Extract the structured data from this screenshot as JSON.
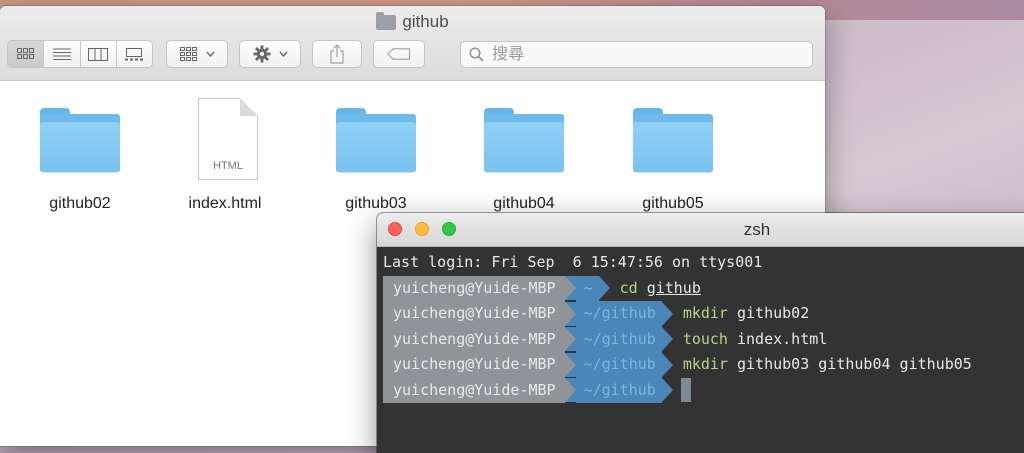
{
  "finder": {
    "title": "github",
    "search": {
      "placeholder": "搜尋"
    },
    "toolbar_icons": [
      "icon-view-grid",
      "list-view-icon",
      "column-view-icon",
      "gallery-view-icon",
      "arrange-icon",
      "gear-icon",
      "share-icon",
      "tag-icon"
    ],
    "files": [
      {
        "name": "github02",
        "kind": "folder"
      },
      {
        "name": "index.html",
        "kind": "document",
        "tag": "HTML"
      },
      {
        "name": "github03",
        "kind": "folder"
      },
      {
        "name": "github04",
        "kind": "folder"
      },
      {
        "name": "github05",
        "kind": "folder"
      }
    ]
  },
  "terminal": {
    "title": "zsh",
    "last_login": "Last login: Fri Sep  6 15:47:56 on ttys001",
    "prompt_user": "yuicheng@Yuide-MBP",
    "lines": [
      {
        "dir": "~",
        "cmd": "cd",
        "args": "github"
      },
      {
        "dir": "~/github",
        "cmd": "mkdir",
        "args": "github02"
      },
      {
        "dir": "~/github",
        "cmd": "touch",
        "args": "index.html"
      },
      {
        "dir": "~/github",
        "cmd": "mkdir",
        "args": "github03 github04 github05"
      },
      {
        "dir": "~/github",
        "cmd": "",
        "args": ""
      }
    ]
  },
  "colors": {
    "prompt_user_bg": "#8f9499",
    "prompt_dir_bg": "#4a86b8",
    "command_green": "#b7d38a",
    "terminal_bg": "#333333",
    "folder_blue": "#79c3f0"
  }
}
